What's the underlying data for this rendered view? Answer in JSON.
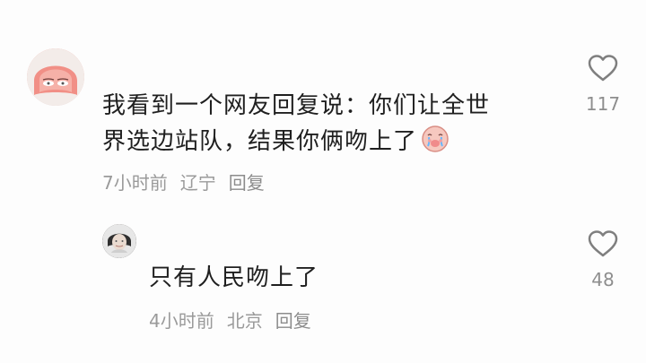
{
  "comments": {
    "main": {
      "text_line1": "我看到一个网友回复说：你们让全世",
      "text_line2": "界选边站队，结果你俩吻上了",
      "emoji": "crying-face",
      "time": "7小时前",
      "location": "辽宁",
      "reply_label": "回复",
      "likes": "117"
    },
    "reply": {
      "text": "只有人民吻上了",
      "time": "4小时前",
      "location": "北京",
      "reply_label": "回复",
      "likes": "48"
    }
  },
  "icons": {
    "like": "heart-outline-icon",
    "avatar_main": "pink-hair-avatar",
    "avatar_reply": "user-photo-avatar",
    "emoji": "crying-emoji-icon"
  }
}
